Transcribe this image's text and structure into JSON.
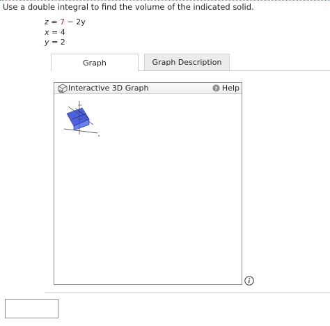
{
  "prompt": "Use a double integral to find the volume of the indicated solid.",
  "equations": {
    "eq1": {
      "lhs": "z",
      "eq": "=",
      "coef": "7",
      "rest": "− 2y"
    },
    "eq2": {
      "lhs": "x",
      "eq": "=",
      "rhs": "4"
    },
    "eq3": {
      "lhs": "y",
      "eq": "=",
      "rhs": "2"
    }
  },
  "tabs": {
    "graph": "Graph",
    "description": "Graph Description"
  },
  "graph_panel": {
    "title": "Interactive 3D Graph",
    "help": "Help"
  },
  "colors": {
    "accent_red": "#d32020",
    "solid_blue": "#3a55d8"
  },
  "icons": {
    "panel": "cube-icon",
    "help": "help-icon",
    "info": "info-icon"
  },
  "answer": {
    "value": ""
  }
}
